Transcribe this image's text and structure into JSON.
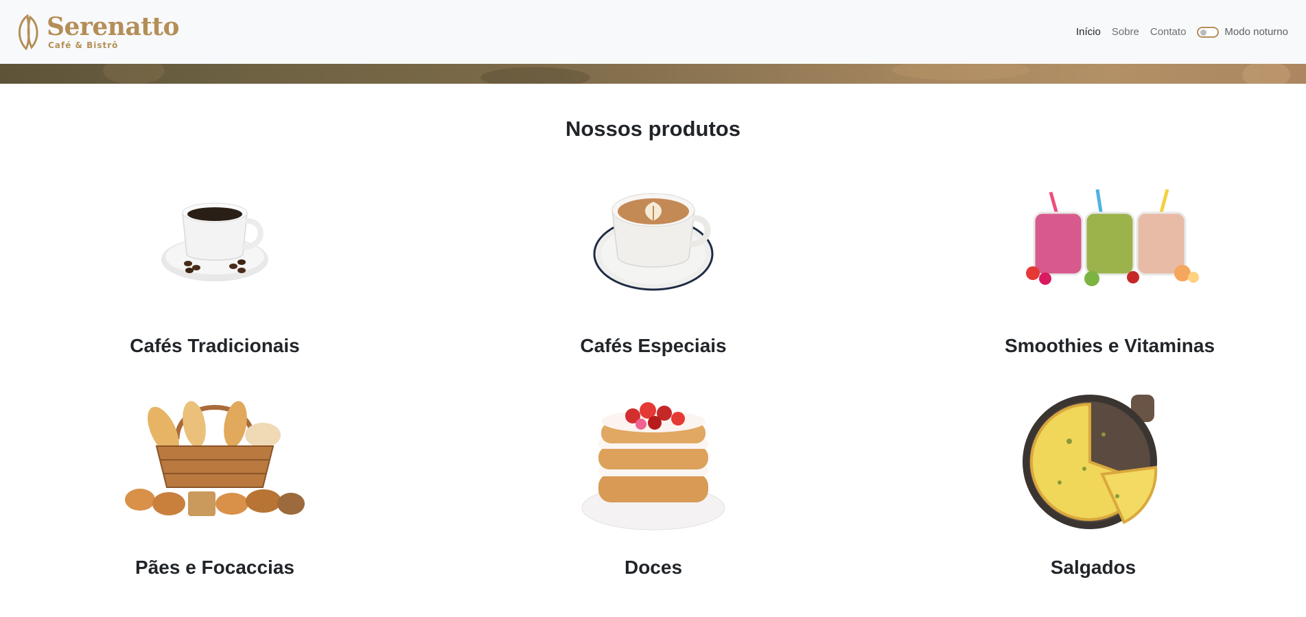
{
  "brand": {
    "name": "Serenatto",
    "subtitle": "Café & Bistrô",
    "color": "#b48e57"
  },
  "nav": {
    "items": [
      {
        "label": "Início",
        "active": true
      },
      {
        "label": "Sobre",
        "active": false
      },
      {
        "label": "Contato",
        "active": false
      }
    ],
    "dark_mode_label": "Modo noturno",
    "dark_mode_on": false
  },
  "products_section": {
    "title": "Nossos produtos",
    "items": [
      {
        "name": "Cafés Tradicionais",
        "icon": "coffee-cup-icon"
      },
      {
        "name": "Cafés Especiais",
        "icon": "cappuccino-icon"
      },
      {
        "name": "Smoothies e Vitaminas",
        "icon": "smoothie-jars-icon"
      },
      {
        "name": "Pães e Focaccias",
        "icon": "bread-basket-icon"
      },
      {
        "name": "Doces",
        "icon": "cake-icon"
      },
      {
        "name": "Salgados",
        "icon": "quiche-icon"
      }
    ]
  }
}
